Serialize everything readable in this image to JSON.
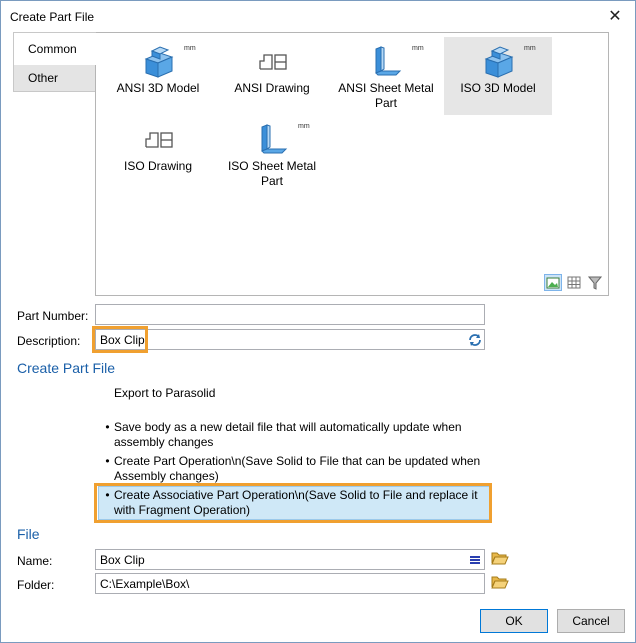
{
  "window": {
    "title": "Create Part File",
    "close_label": "✕"
  },
  "tabs": [
    {
      "label": "Common",
      "selected": true
    },
    {
      "label": "Other",
      "selected": false
    }
  ],
  "templates": [
    {
      "label": "ANSI 3D Model",
      "icon": "solid-block-icon",
      "unit": "mm"
    },
    {
      "label": "ANSI Drawing",
      "icon": "drawing-sheet-icon",
      "unit": ""
    },
    {
      "label": "ANSI Sheet Metal Part",
      "icon": "sheet-metal-icon",
      "unit": "mm"
    },
    {
      "label": "ISO 3D Model",
      "icon": "solid-block-icon",
      "unit": "mm",
      "selected": true
    },
    {
      "label": "ISO Drawing",
      "icon": "drawing-sheet-icon",
      "unit": ""
    },
    {
      "label": "ISO Sheet Metal Part",
      "icon": "sheet-metal-icon",
      "unit": "mm"
    }
  ],
  "view_buttons": [
    "large-icons-view-icon",
    "list-view-icon",
    "filter-icon"
  ],
  "form": {
    "part_number_label": "Part Number:",
    "part_number_value": "",
    "description_label": "Description:",
    "description_value": "Box Clip"
  },
  "create_section": {
    "title": "Create Part File",
    "options": [
      {
        "text": "Export to Parasolid",
        "bullet": false
      },
      {
        "text": "Save body as a new detail file that will automatically update when assembly changes",
        "bullet": true
      },
      {
        "text": "Create Part Operation\\n(Save Solid to File that can be  updated when Assembly changes)",
        "bullet": true
      },
      {
        "text": "Create Associative Part Operation\\n(Save Solid to File and replace it with Fragment Operation)",
        "bullet": true,
        "selected": true
      }
    ]
  },
  "file_section": {
    "title": "File",
    "name_label": "Name:",
    "name_value": "Box Clip",
    "folder_label": "Folder:",
    "folder_value": "C:\\Example\\Box\\"
  },
  "buttons": {
    "ok": "OK",
    "cancel": "Cancel"
  },
  "colors": {
    "accent": "#1a5fa8",
    "highlight": "#f0a030",
    "selection": "#cfe8f7",
    "icon_blue": "#3b8fd9"
  }
}
